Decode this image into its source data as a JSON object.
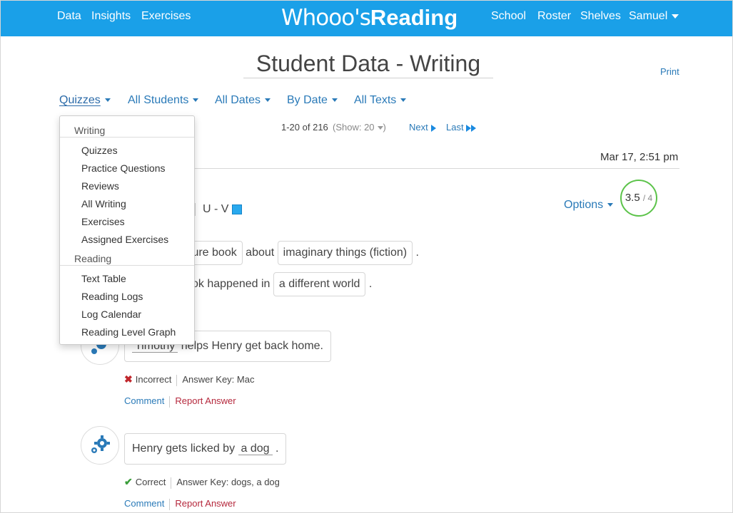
{
  "nav": {
    "left": [
      "Data",
      "Insights",
      "Exercises"
    ],
    "logo_part1": "Whooo's",
    "logo_part2": "Reading",
    "right": [
      "School",
      "Roster",
      "Shelves"
    ],
    "user": "Samuel"
  },
  "page": {
    "title": "Student Data - Writing",
    "print": "Print"
  },
  "filters": [
    "Quizzes",
    "All Students",
    "All Dates",
    "By Date",
    "All Texts"
  ],
  "pager": {
    "range": "1-20 of 216",
    "show": "(Show: 20",
    "show_close": ")",
    "next": "Next",
    "last": "Last"
  },
  "entry": {
    "date": "Mar 17, 2:51 pm",
    "level": "U - V",
    "options": "Options",
    "score": "3.5",
    "score_total": "/ 4",
    "sentence1": {
      "box1": "cture book",
      "mid": "about",
      "box2": "imaginary things (fiction)",
      "end": "."
    },
    "sentence2": {
      "pre": "ok happened in",
      "box": "a different world",
      "end": "."
    }
  },
  "questions": [
    {
      "answer": "Timothy",
      "rest": "helps Henry get back home.",
      "status": "Incorrect",
      "key": "Answer Key: Mac",
      "comment": "Comment",
      "report": "Report Answer"
    },
    {
      "pre": "Henry gets licked by",
      "answer": "a dog",
      "end": ".",
      "status": "Correct",
      "key": "Answer Key: dogs, a dog",
      "comment": "Comment",
      "report": "Report Answer"
    }
  ],
  "dropdown": {
    "writing_header": "Writing",
    "writing_items": [
      "Quizzes",
      "Practice Questions",
      "Reviews",
      "All Writing",
      "Exercises",
      "Assigned Exercises"
    ],
    "reading_header": "Reading",
    "reading_items": [
      "Text Table",
      "Reading Logs",
      "Log Calendar",
      "Reading Level Graph"
    ]
  },
  "colors": {
    "nav": "#1aa0e8",
    "link": "#2a7ab8",
    "score_ring": "#5cc34a",
    "incorrect": "#c0262c",
    "correct": "#3a9e3a"
  }
}
